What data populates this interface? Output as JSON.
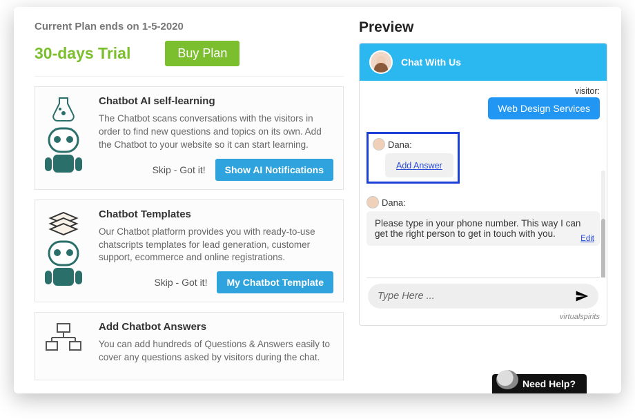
{
  "plan": {
    "ends_label": "Current Plan ends on 1-5-2020",
    "title": "30-days Trial",
    "buy_label": "Buy Plan"
  },
  "cards": [
    {
      "title": "Chatbot AI self-learning",
      "desc": "The Chatbot scans conversations with the visitors in order to find new questions and topics on its own. Add the Chatbot to your website so it can start learning.",
      "skip": "Skip - Got it!",
      "cta": "Show AI Notifications"
    },
    {
      "title": "Chatbot Templates",
      "desc": "Our Chatbot platform provides you with ready-to-use chatscripts templates for lead generation, customer support, ecommerce and online registrations.",
      "skip": "Skip - Got it!",
      "cta": "My Chatbot Template"
    },
    {
      "title": "Add Chatbot Answers",
      "desc": "You can add hundreds of Questions & Answers easily to cover any questions asked by visitors during the chat."
    }
  ],
  "preview": {
    "heading": "Preview",
    "chat_title": "Chat With Us",
    "visitor_label": "visitor:",
    "visitor_msg": "Web Design Services",
    "agent_name": "Dana:",
    "add_answer": "Add Answer",
    "agent_msg": "Please type in your phone number. This way I can get the right person to get in touch with you.",
    "edit": "Edit",
    "input_placeholder": "Type Here ...",
    "brand": "virtualspirits",
    "need_help": "Need Help?"
  }
}
